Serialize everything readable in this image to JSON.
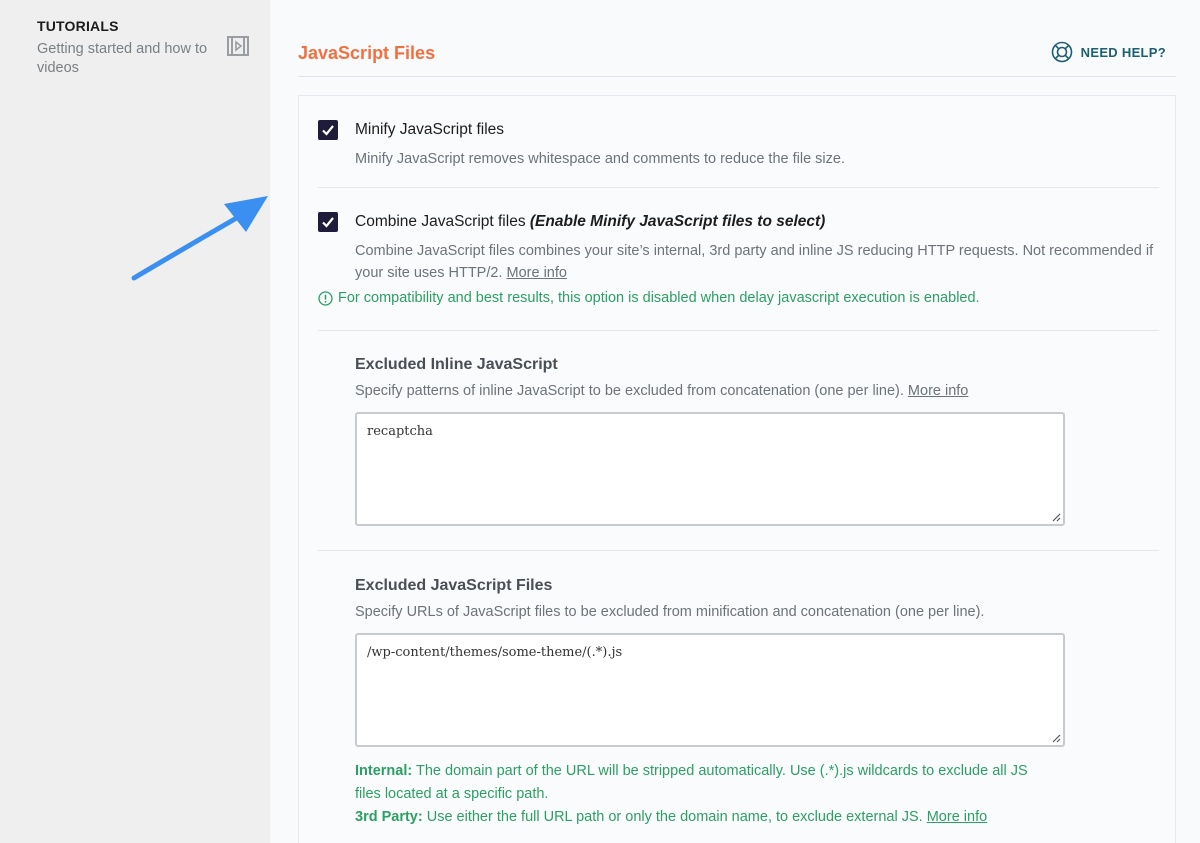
{
  "sidebar": {
    "tutorials_title": "TUTORIALS",
    "tutorials_desc": "Getting started and how to videos"
  },
  "header": {
    "title": "JavaScript Files",
    "help_label": "NEED HELP?"
  },
  "minify": {
    "label": "Minify JavaScript files",
    "checked": true,
    "description": "Minify JavaScript removes whitespace and comments to reduce the file size."
  },
  "combine": {
    "label": "Combine JavaScript files",
    "label_note": "(Enable Minify JavaScript files to select)",
    "checked": true,
    "description": "Combine JavaScript files combines your site’s internal, 3rd party and inline JS reducing HTTP requests. Not recommended if your site uses HTTP/2.",
    "more_info": "More info",
    "warning": "For compatibility and best results, this option is disabled when delay javascript execution is enabled."
  },
  "excluded_inline": {
    "title": "Excluded Inline JavaScript",
    "description": "Specify patterns of inline JavaScript to be excluded from concatenation (one per line).",
    "more_info": "More info",
    "value": "recaptcha"
  },
  "excluded_files": {
    "title": "Excluded JavaScript Files",
    "description": "Specify URLs of JavaScript files to be excluded from minification and concatenation (one per line).",
    "value": "/wp-content/themes/some-theme/(.*).js",
    "internal_label": "Internal:",
    "internal_text": "The domain part of the URL will be stripped automatically. Use (.*).js wildcards to exclude all JS files located at a specific path.",
    "third_label": "3rd Party:",
    "third_text": "Use either the full URL path or only the domain name, to exclude external JS.",
    "more_info": "More info"
  },
  "colors": {
    "accent": "#f2703f",
    "checkbox": "#1f1b3a",
    "success": "#2c9f63",
    "help": "#1c5f72",
    "arrow": "#3a8ff0"
  }
}
